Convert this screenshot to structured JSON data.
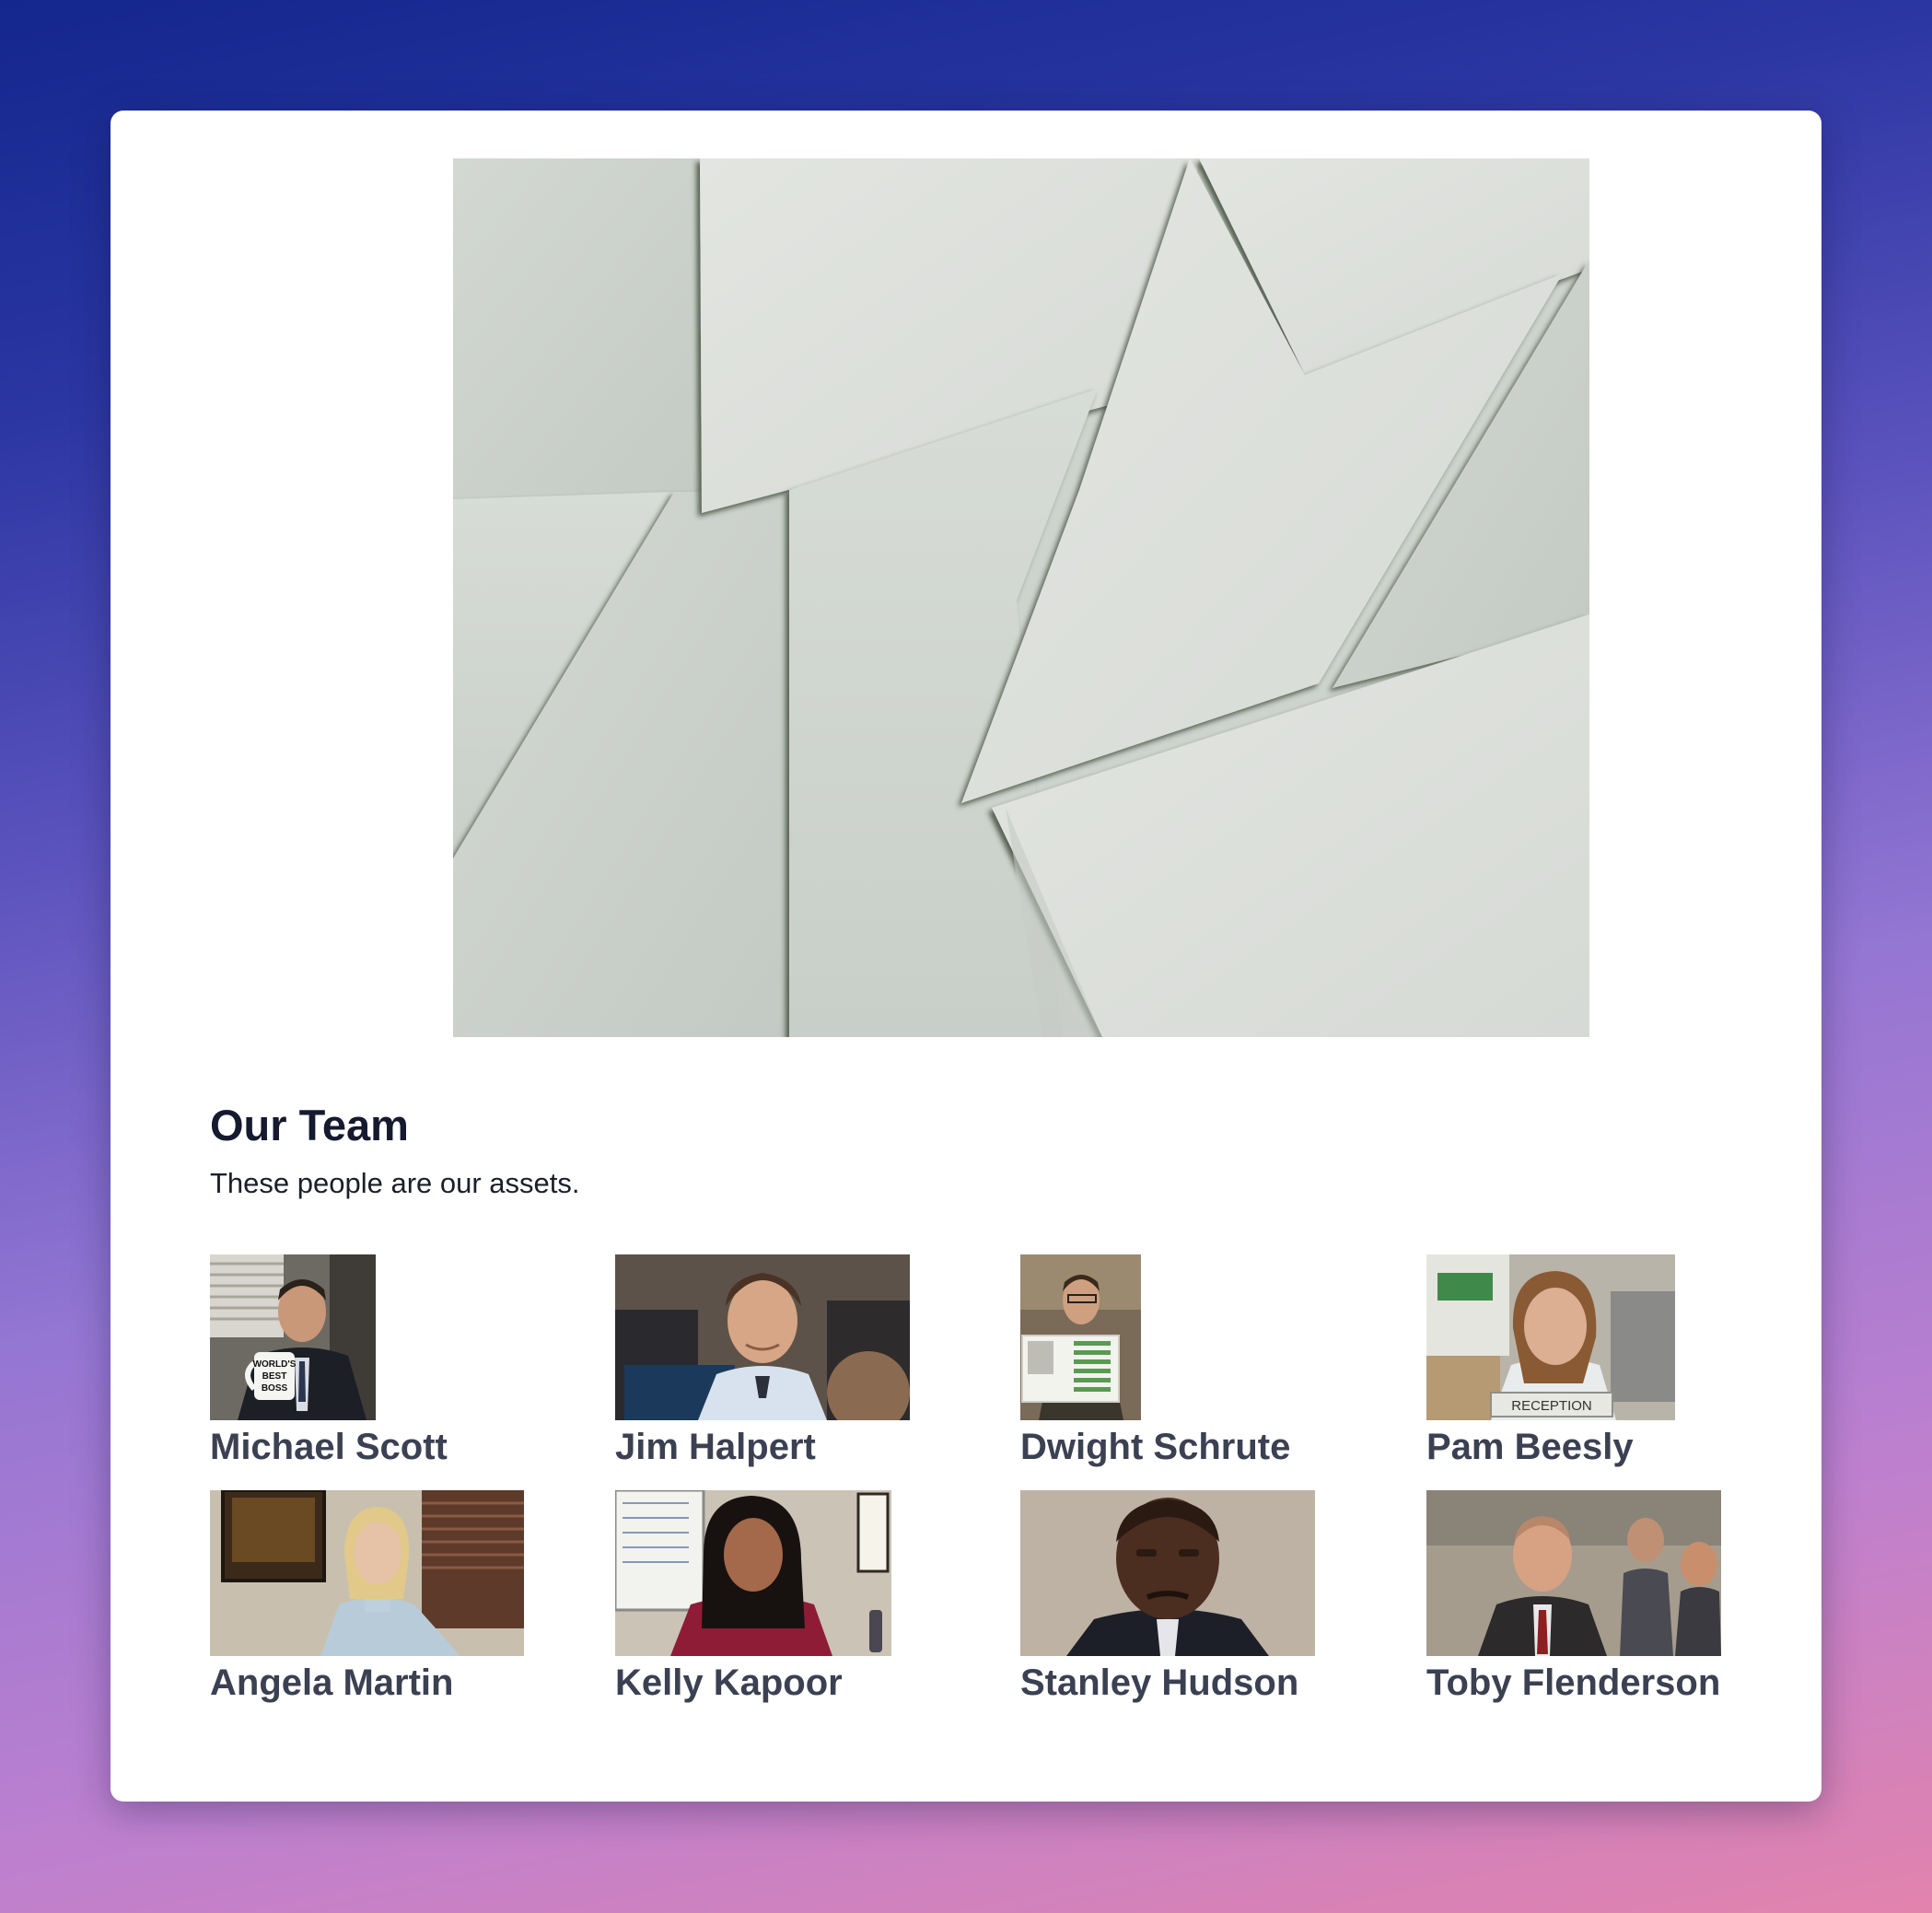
{
  "hero": {
    "image_name": "paper-sheets-photo",
    "colors": {
      "paper_light": "#dfe3de",
      "paper_mid": "#cfd5cf",
      "shadow": "#3f4a3d"
    }
  },
  "team": {
    "title": "Our Team",
    "subtitle": "These people are our assets.",
    "members": [
      {
        "name": "Michael Scott",
        "mug_text": "WORLD'S BEST BOSS"
      },
      {
        "name": "Jim Halpert"
      },
      {
        "name": "Dwight Schrute"
      },
      {
        "name": "Pam Beesly",
        "sign_text": "RECEPTION"
      },
      {
        "name": "Angela Martin"
      },
      {
        "name": "Kelly Kapoor"
      },
      {
        "name": "Stanley Hudson"
      },
      {
        "name": "Toby Flenderson"
      }
    ]
  },
  "colors": {
    "gradient_top": "#13278e",
    "gradient_bottom": "#e283ad",
    "card_bg": "#ffffff",
    "title_text": "#151a2e",
    "name_text": "#3b4152"
  }
}
